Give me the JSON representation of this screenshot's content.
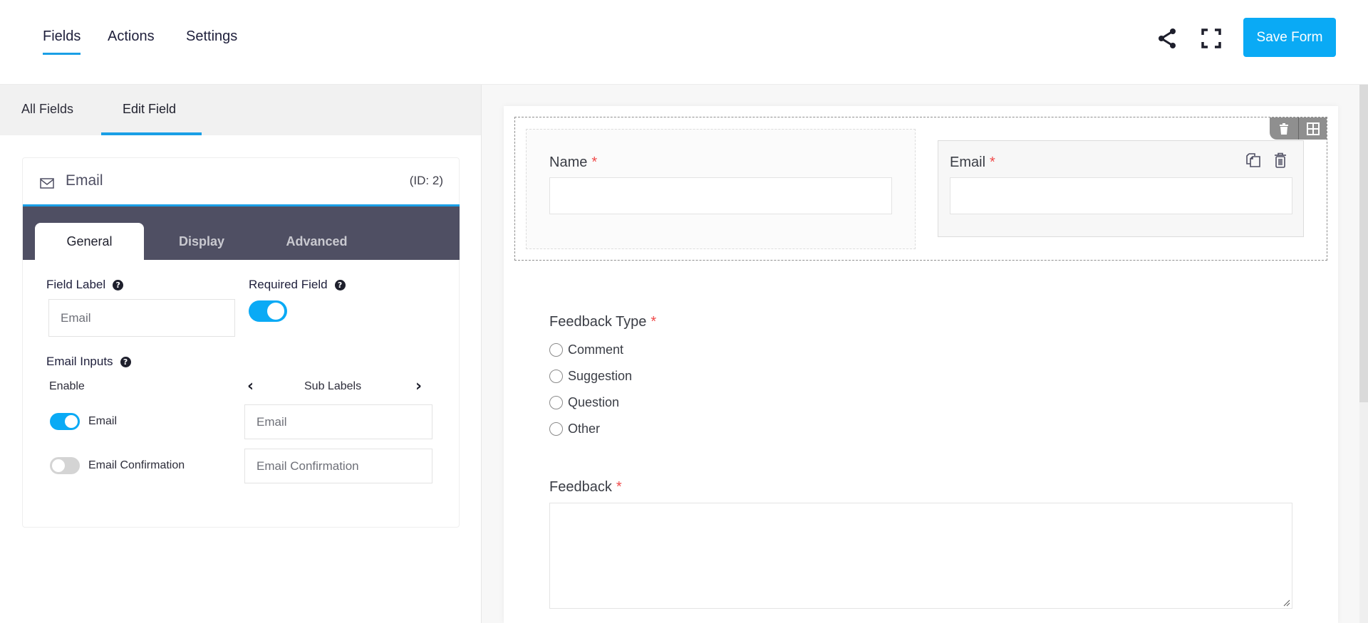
{
  "header": {
    "nav": [
      {
        "label": "Fields",
        "active": true
      },
      {
        "label": "Actions",
        "active": false
      },
      {
        "label": "Settings",
        "active": false
      }
    ],
    "share_icon": "share-icon",
    "fullscreen_icon": "fullscreen-icon",
    "save_label": "Save Form",
    "accent_color": "#0aaaf5"
  },
  "left_panel": {
    "tabs": [
      {
        "label": "All Fields",
        "active": false
      },
      {
        "label": "Edit Field",
        "active": true
      }
    ],
    "field_card": {
      "icon": "envelope-icon",
      "title": "Email",
      "id_text": "(ID: 2)",
      "tabs": [
        {
          "label": "General",
          "active": true
        },
        {
          "label": "Display",
          "active": false
        },
        {
          "label": "Advanced",
          "active": false
        }
      ],
      "general": {
        "field_label": {
          "label": "Field Label",
          "help": "?",
          "value": "Email"
        },
        "required_field": {
          "label": "Required Field",
          "help": "?",
          "enabled": true
        },
        "email_inputs": {
          "label": "Email Inputs",
          "help": "?",
          "enable_header": "Enable",
          "sublabels_header": "Sub Labels",
          "prev_arrow": "‹",
          "next_arrow": "›",
          "rows": [
            {
              "name": "Email",
              "enabled": true,
              "sublabel": "Email"
            },
            {
              "name": "Email Confirmation",
              "enabled": false,
              "sublabel": "Email Confirmation"
            }
          ]
        }
      }
    }
  },
  "form_preview": {
    "row_toolbar": {
      "delete_icon": "trash-icon",
      "columns_icon": "columns-grid-icon"
    },
    "fields": {
      "name": {
        "label": "Name",
        "required_mark": "*",
        "value": ""
      },
      "email": {
        "label": "Email",
        "required_mark": "*",
        "value": "",
        "duplicate_icon": "duplicate-icon",
        "delete_icon": "trash-outline-icon"
      },
      "feedback_type": {
        "label": "Feedback Type",
        "required_mark": "*",
        "options": [
          "Comment",
          "Suggestion",
          "Question",
          "Other"
        ]
      },
      "feedback": {
        "label": "Feedback",
        "required_mark": "*",
        "value": ""
      }
    }
  }
}
